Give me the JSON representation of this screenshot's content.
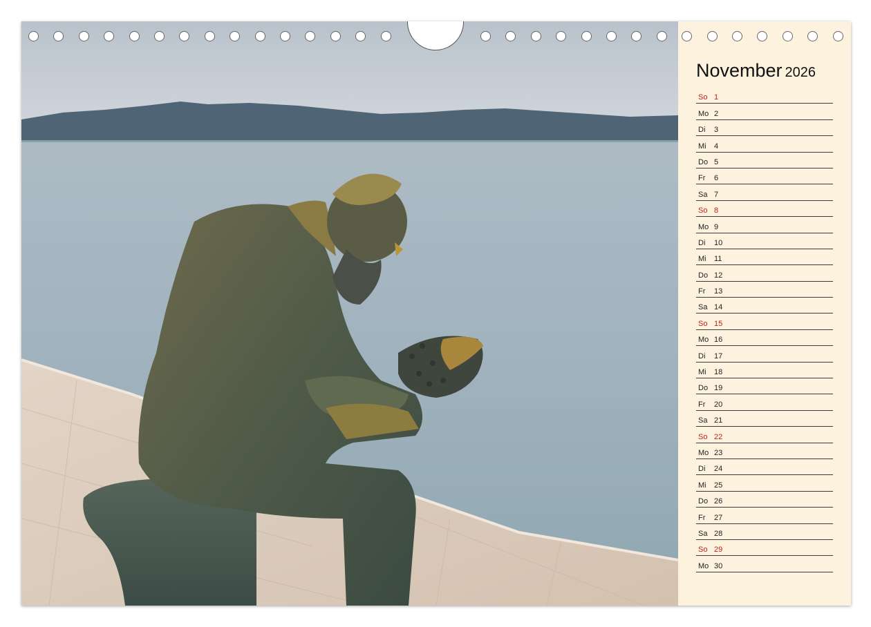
{
  "calendar": {
    "month": "November",
    "year": "2026",
    "days": [
      {
        "wd": "So",
        "d": "1",
        "sunday": true
      },
      {
        "wd": "Mo",
        "d": "2"
      },
      {
        "wd": "Di",
        "d": "3"
      },
      {
        "wd": "Mi",
        "d": "4"
      },
      {
        "wd": "Do",
        "d": "5"
      },
      {
        "wd": "Fr",
        "d": "6"
      },
      {
        "wd": "Sa",
        "d": "7"
      },
      {
        "wd": "So",
        "d": "8",
        "sunday": true
      },
      {
        "wd": "Mo",
        "d": "9"
      },
      {
        "wd": "Di",
        "d": "10"
      },
      {
        "wd": "Mi",
        "d": "11"
      },
      {
        "wd": "Do",
        "d": "12"
      },
      {
        "wd": "Fr",
        "d": "13"
      },
      {
        "wd": "Sa",
        "d": "14"
      },
      {
        "wd": "So",
        "d": "15",
        "sunday": true
      },
      {
        "wd": "Mo",
        "d": "16"
      },
      {
        "wd": "Di",
        "d": "17"
      },
      {
        "wd": "Mi",
        "d": "18"
      },
      {
        "wd": "Do",
        "d": "19"
      },
      {
        "wd": "Fr",
        "d": "20"
      },
      {
        "wd": "Sa",
        "d": "21"
      },
      {
        "wd": "So",
        "d": "22",
        "sunday": true
      },
      {
        "wd": "Mo",
        "d": "23"
      },
      {
        "wd": "Di",
        "d": "24"
      },
      {
        "wd": "Mi",
        "d": "25"
      },
      {
        "wd": "Do",
        "d": "26"
      },
      {
        "wd": "Fr",
        "d": "27"
      },
      {
        "wd": "Sa",
        "d": "28"
      },
      {
        "wd": "So",
        "d": "29",
        "sunday": true
      },
      {
        "wd": "Mo",
        "d": "30"
      }
    ]
  },
  "colors": {
    "panel_background": "#fdf2de",
    "sunday_text": "#c0201b",
    "weekday_text": "#222222",
    "rule_line": "#3a3a3a"
  },
  "photo": {
    "subject": "bronze statue of seated man holding a shell, seaside promenade"
  }
}
